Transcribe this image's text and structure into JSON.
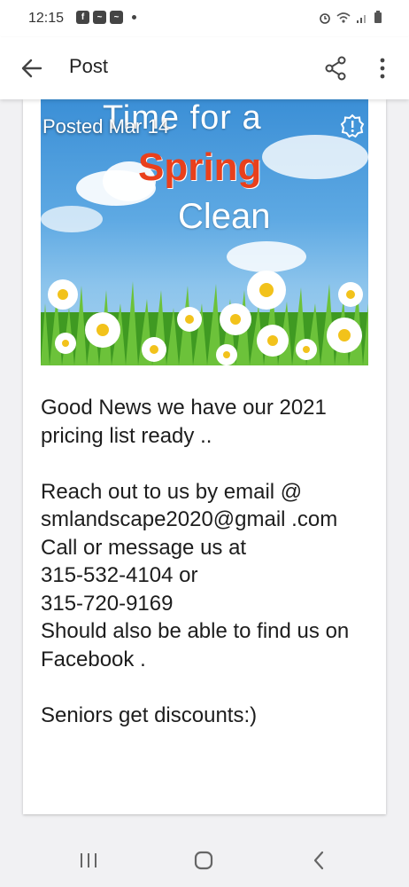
{
  "status_bar": {
    "time": "12:15",
    "left_icons": [
      "facebook-icon",
      "app-icon",
      "app-icon"
    ],
    "right_icons": [
      "alarm-icon",
      "wifi-icon",
      "signal-icon",
      "battery-icon"
    ]
  },
  "app_bar": {
    "title": "Post",
    "back_icon": "arrow-left-icon",
    "share_icon": "share-icon",
    "more_icon": "more-vert-icon"
  },
  "post": {
    "posted_date": "Posted Mar 14",
    "image": {
      "line1": "Time for a",
      "line2": "Spring",
      "line3": "Clean"
    },
    "body": "Good News we have our 2021 pricing list ready ..\n\nReach out to us by email @ smlandscape2020@gmail .com\nCall or message us at\n315-532-4104 or\n315-720-9169\nShould also be able to find us on Facebook .\n\nSeniors get discounts:)"
  },
  "nav_bar": {
    "icons": [
      "recents-icon",
      "home-icon",
      "back-icon"
    ]
  },
  "colors": {
    "spring_text": "#e9401c",
    "sky": "#3b8fd6",
    "grass": "#4caf2a"
  }
}
